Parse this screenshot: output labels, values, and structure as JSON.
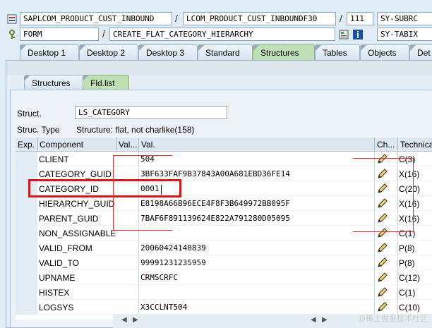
{
  "header": {
    "row1": {
      "program": "SAPLCOM_PRODUCT_CUST_INBOUND",
      "include": "LCOM_PRODUCT_CUST_INBOUNDF30",
      "line": "111",
      "sysvar": "SY-SUBRC"
    },
    "row2": {
      "event_type": "FORM",
      "event": "CREATE_FLAT_CATEGORY_HIERARCHY",
      "sysvar": "SY-TABIX"
    }
  },
  "main_tabs": [
    "Desktop 1",
    "Desktop 2",
    "Desktop 3",
    "Standard",
    "Structures",
    "Tables",
    "Objects",
    "Det"
  ],
  "sub_tabs": [
    "Structures",
    "Fld.list"
  ],
  "struct": {
    "label": "Struct.",
    "value": "LS_CATEGORY"
  },
  "struc_type": {
    "label": "Struc. Type",
    "value": "Structure: flat, not charlike(158)"
  },
  "table": {
    "headers": {
      "exp": "Exp.",
      "component": "Component",
      "val_short": "Val...",
      "val": "Val.",
      "ch": "Ch...",
      "technical": "Technica"
    },
    "rows": [
      {
        "component": "CLIENT",
        "value": "504",
        "tech": "C(3)"
      },
      {
        "component": "CATEGORY_GUID",
        "value": "3BF633FAF9B37843A00A681EBD36FE14",
        "tech": "X(16)"
      },
      {
        "component": "CATEGORY_ID",
        "value": "0001",
        "tech": "C(20)"
      },
      {
        "component": "HIERARCHY_GUID",
        "value": "E8198A66B96ECE4F8F3B649972BB095F",
        "tech": "X(16)"
      },
      {
        "component": "PARENT_GUID",
        "value": "7BAF6F891139624E822A791280D05095",
        "tech": "X(16)"
      },
      {
        "component": "NON_ASSIGNABLE",
        "value": "",
        "tech": "C(1)"
      },
      {
        "component": "VALID_FROM",
        "value": "20060424140839",
        "tech": "P(8)"
      },
      {
        "component": "VALID_TO",
        "value": "99991231235959",
        "tech": "P(8)"
      },
      {
        "component": "UPNAME",
        "value": "CRMSCRFC",
        "tech": "C(12)"
      },
      {
        "component": "HISTEX",
        "value": "",
        "tech": "C(1)"
      },
      {
        "component": "LOGSYS",
        "value": "X3CCLNT504",
        "tech": "C(10)"
      }
    ]
  },
  "watermark": "@稀土掘金技术社区",
  "colors": {
    "highlight_border": "#d21a1a",
    "active_tab": "#bfe0b5",
    "background": "#dfebf5"
  }
}
